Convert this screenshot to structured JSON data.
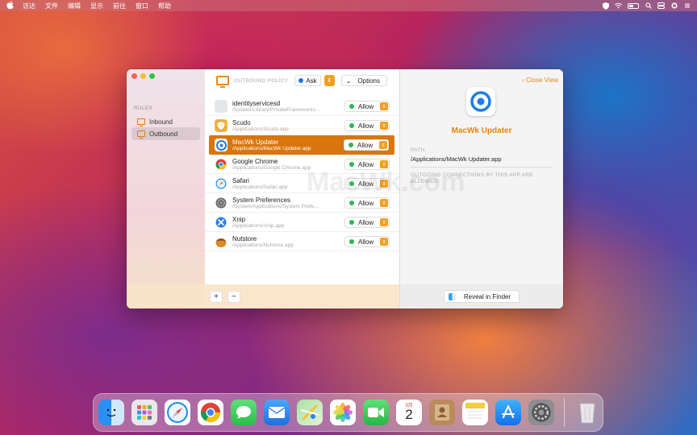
{
  "menubar": {
    "items": [
      "访达",
      "文件",
      "编辑",
      "显示",
      "前往",
      "窗口",
      "帮助"
    ]
  },
  "sidebar": {
    "section_label": "RULES",
    "items": [
      {
        "label": "Inbound"
      },
      {
        "label": "Outbound"
      }
    ]
  },
  "toolbar": {
    "policy_label": "OUTBOUND POLICY",
    "ask_label": "Ask",
    "options_label": "Options"
  },
  "apps": [
    {
      "name": "identityservicesd",
      "path": "/System/Library/PrivateFrameworks...",
      "action": "Allow",
      "icon": "generic-app-icon"
    },
    {
      "name": "Scudo",
      "path": "/Applications/Scudo.app",
      "action": "Allow",
      "icon": "scudo-shield-icon"
    },
    {
      "name": "MacWk Updater",
      "path": "/Applications/MacWk Updater.app",
      "action": "Allow",
      "icon": "macwk-updater-icon"
    },
    {
      "name": "Google Chrome",
      "path": "/Applications/Google Chrome.app",
      "action": "Allow",
      "icon": "chrome-icon"
    },
    {
      "name": "Safari",
      "path": "/Applications/Safari.app",
      "action": "Allow",
      "icon": "safari-icon"
    },
    {
      "name": "System Preferences",
      "path": "/System/Applications/System Prefe...",
      "action": "Allow",
      "icon": "system-preferences-icon"
    },
    {
      "name": "Xnip",
      "path": "/Applications/Xnip.app",
      "action": "Allow",
      "icon": "xnip-icon"
    },
    {
      "name": "Nutstore",
      "path": "/Applications/Nutstore.app",
      "action": "Allow",
      "icon": "nutstore-icon"
    }
  ],
  "footer": {
    "add_label": "+",
    "remove_label": "−"
  },
  "detail": {
    "close_label": "Close View",
    "title": "MacWk Updater",
    "path_label": "PATH",
    "path_value": "/Applications/MacWk Updater.app",
    "outgoing_label": "OUTGOING CONNECTIONS BY THIS APP ARE ALLOWED",
    "reveal_label": "Reveal in Finder"
  },
  "watermark": "MacWk.com",
  "dock": {
    "calendar_month": "3月",
    "calendar_day": "2"
  },
  "colors": {
    "accent": "#e8840f",
    "selected_row": "#d8750c",
    "allow_dot": "#2db84d",
    "ask_dot": "#1e78e6"
  }
}
